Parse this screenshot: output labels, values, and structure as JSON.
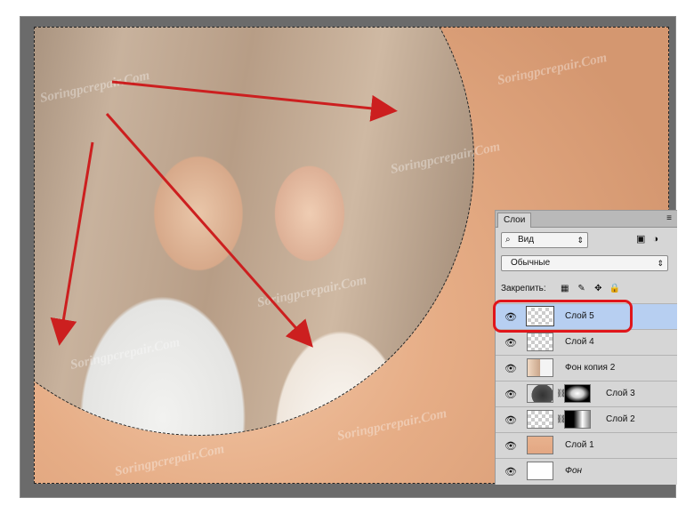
{
  "watermark": "Soringpcrepair.Com",
  "layers_panel": {
    "tab_label": "Слои",
    "menu_icon": "panel-menu-icon",
    "filter": {
      "kind_label": "Вид",
      "icons": [
        "image-filter-icon",
        "adjustment-filter-icon"
      ]
    },
    "blend_mode": "Обычные",
    "lock_label": "Закрепить:",
    "lock_icons": [
      "lock-transparent-icon",
      "lock-brush-icon",
      "lock-move-icon",
      "lock-all-icon"
    ],
    "layers": [
      {
        "name": "Слой 5",
        "selected": true,
        "thumb": "transparent"
      },
      {
        "name": "Слой 4",
        "selected": false,
        "thumb": "transparent"
      },
      {
        "name": "Фон копия 2",
        "selected": false,
        "thumb": "photo"
      },
      {
        "name": "Слой 3",
        "selected": false,
        "thumb": "dark",
        "mask": "radial"
      },
      {
        "name": "Слой 2",
        "selected": false,
        "thumb": "transparent",
        "mask": "gradient"
      },
      {
        "name": "Слой 1",
        "selected": false,
        "thumb": "peach"
      },
      {
        "name": "Фон",
        "selected": false,
        "thumb": "white"
      }
    ]
  },
  "colors": {
    "arrow": "#cc1f1f",
    "highlight": "#e0161b",
    "selected_row": "#b7cff1",
    "background_peach": "#e6ad86"
  }
}
